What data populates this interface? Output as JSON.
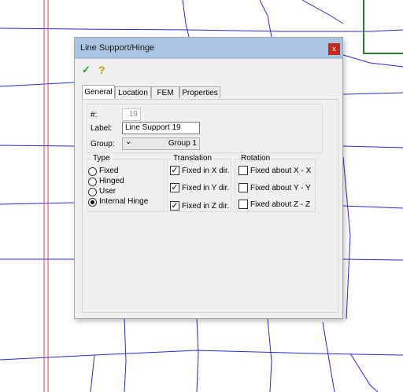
{
  "dialog": {
    "title": "Line Support/Hinge",
    "close_glyph": "x"
  },
  "toolbar": {
    "ok_icon": "checkmark-icon",
    "help_icon": "help-icon",
    "ok_glyph": "✓",
    "help_glyph": "?"
  },
  "tabs": [
    {
      "label": "General",
      "active": true
    },
    {
      "label": "Location",
      "active": false
    },
    {
      "label": "FEM",
      "active": false
    },
    {
      "label": "Properties",
      "active": false
    }
  ],
  "general": {
    "number_label": "#:",
    "number_value": "19",
    "label_label": "Label:",
    "label_value": "Line Support 19",
    "group_label": "Group:",
    "group_value": "Group 1",
    "group_chevron": "⌄"
  },
  "type": {
    "title": "Type",
    "options": [
      {
        "label": "Fixed",
        "selected": false
      },
      {
        "label": "Hinged",
        "selected": false
      },
      {
        "label": "User",
        "selected": false
      },
      {
        "label": "Internal Hinge",
        "selected": true
      }
    ]
  },
  "translation": {
    "title": "Translation",
    "options": [
      {
        "label": "Fixed in X dir.",
        "checked": true
      },
      {
        "label": "Fixed in Y dir.",
        "checked": true
      },
      {
        "label": "Fixed in Z dir.",
        "checked": true
      }
    ]
  },
  "rotation": {
    "title": "Rotation",
    "options": [
      {
        "label": "Fixed about X - X",
        "checked": false
      },
      {
        "label": "Fixed about Y - Y",
        "checked": false
      },
      {
        "label": "Fixed about Z - Z",
        "checked": false
      }
    ]
  },
  "colors": {
    "mesh": "#2a2ad0",
    "support_line": "#d04848",
    "highlight": "#2e7d2e",
    "titlebar": "#a9c4e0",
    "close": "#c42b1c",
    "ok_check": "#2aa02a",
    "help": "#c89b00"
  }
}
